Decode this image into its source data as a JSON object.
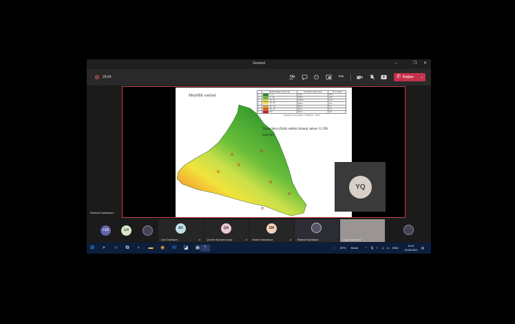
{
  "window": {
    "title": "General"
  },
  "toolbar": {
    "timer": "29:04",
    "leave_label": "Bağlan"
  },
  "slide": {
    "title": "Meyillik xəritəsi",
    "text": "Yamacların (fiziki səthin) ümumi sahəsi 12 296 km2-dir.",
    "legend": {
      "headers": [
        "Meyillik çalarları, dərəcə ilə",
        "Yamacların sahəsi, km2",
        "% -lə nisbəti"
      ],
      "rows": [
        {
          "num": "1",
          "range": "0 - 3",
          "area": "4744",
          "pct": "38.5",
          "color": "#1f8a2a"
        },
        {
          "num": "2",
          "range": "3 - 10",
          "area": "2753.7",
          "pct": "22.4",
          "color": "#6cbf3a"
        },
        {
          "num": "3",
          "range": "10 - 20",
          "area": "1646.8",
          "pct": "13.9",
          "color": "#c8e04a"
        },
        {
          "num": "4",
          "range": "20 - 25",
          "area": "1094.7",
          "pct": "8.9",
          "color": "#f2e23c"
        },
        {
          "num": "5",
          "range": "25 - 35",
          "area": "984.3",
          "pct": "8.1",
          "color": "#f5a22e"
        },
        {
          "num": "6",
          "range": "35 - 45",
          "area": "630.7",
          "pct": "5.1",
          "color": "#e8591f"
        },
        {
          "num": "7",
          "range": "45 <",
          "area": "441.7",
          "pct": "3.6",
          "color": "#c51c1c"
        }
      ],
      "footer_label": "Yamacların ümumi sahəsi - 12 296 km2",
      "footer_total": "100 %"
    }
  },
  "presenter": {
    "name": "Rashad Sadullayev"
  },
  "spotlight_tile": {
    "initials": "YQ"
  },
  "participants": [
    {
      "initials": "+13",
      "name": "",
      "color": "#6264a7"
    },
    {
      "initials": "LH",
      "name": "",
      "color": "#d6e8c8"
    },
    {
      "initials": "",
      "name": "",
      "color": "#556"
    },
    {
      "initials": "AC",
      "name": "Azal Caviliayev",
      "color": "#bfe0e8"
    },
    {
      "initials": "QA",
      "name": "Qonche Nurayeva Ayaz",
      "color": "#f0c8d8"
    },
    {
      "initials": "SM",
      "name": "Shaker Mamadova",
      "color": "#f5d0b8"
    },
    {
      "initials": "",
      "name": "Rashad Sadullayev",
      "color": "#ccc"
    },
    {
      "initials": "",
      "name": "Vugar Camberov",
      "color": "#bbb"
    },
    {
      "initials": "",
      "name": "",
      "color": "#667"
    }
  ],
  "taskbar": {
    "weather": "23°C",
    "weather_desc": "Bovlu",
    "lang": "ENG",
    "time": "11:21",
    "date": "23.06.2021"
  },
  "icons": {
    "people": "people-icon",
    "chat": "chat-icon",
    "react": "react-icon",
    "rooms": "rooms-icon",
    "more": "more-icon",
    "camera": "camera-icon",
    "mic": "mic-off-icon",
    "share": "share-icon",
    "phone": "phone-icon"
  }
}
